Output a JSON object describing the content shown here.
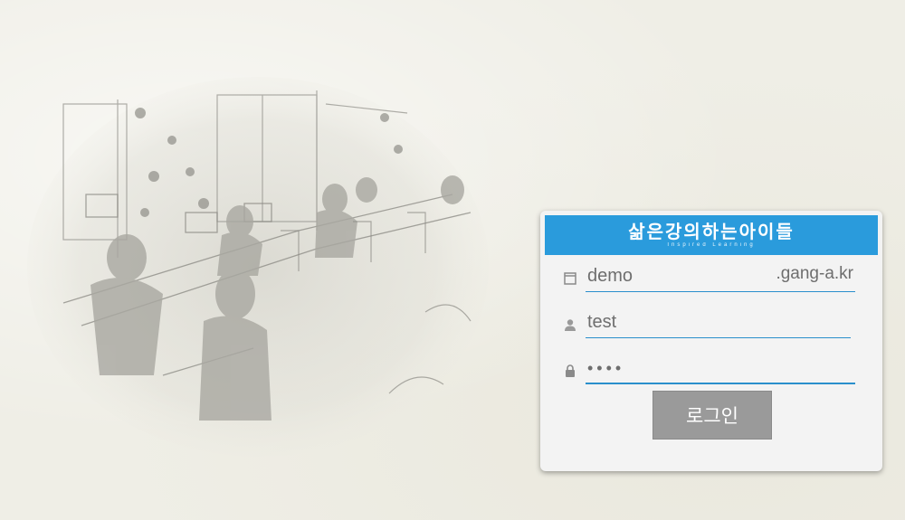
{
  "background": {
    "illustration": "classroom-sketch"
  },
  "login": {
    "logo_text": "삶은강의하는아이들",
    "logo_subtext": "Inspired Learning",
    "header_color": "#2a9bdc",
    "domain": {
      "value": "demo",
      "suffix": ".gang-a.kr",
      "icon": "window-icon"
    },
    "username": {
      "value": "test",
      "icon": "user-icon"
    },
    "password": {
      "value": "••••",
      "icon": "lock-icon"
    },
    "button_label": "로그인",
    "button_color": "#9a9a9a"
  }
}
